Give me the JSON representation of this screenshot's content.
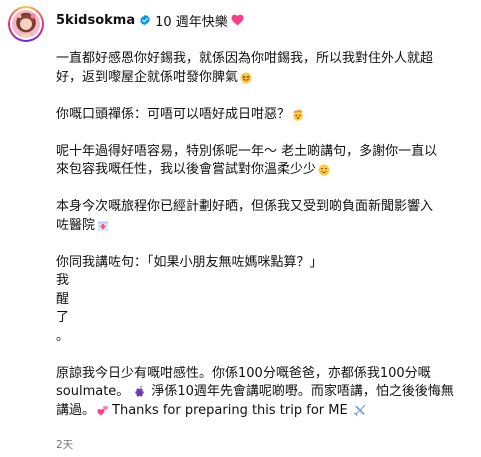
{
  "post": {
    "username": "5kidsokma",
    "title": "10 週年快樂",
    "timestamp": "2天"
  },
  "caption": {
    "p1_l1": "一直都好感恩你好錫我，就係因為你咁錫我，所以我對住外人就超",
    "p1_l2": "好，返到嚟屋企就係咁發你脾氣",
    "p2_l1": "你嘅口頭禪係：可唔可以唔好成日咁惡？",
    "p3_l1": "呢十年過得好唔容易，特別係呢一年～ 老土啲講句，多謝你一直以",
    "p3_l2": "來包容我嘅任性，我以後會嘗試對你溫柔少少",
    "p4_l1": "本身今次嘅旅程你已經計劃好晒，但係我又受到啲負面新聞影響入",
    "p4_l2": "咗醫院",
    "p5_l1": "你同我講咗句：「如果小朋友無咗媽咪點算？」",
    "p5_c1": "我",
    "p5_c2": "醒",
    "p5_c3": "了",
    "p5_c4": "。",
    "p6_l1": "原諒我今日少有嘅咁感性。你係100分嘅爸爸，亦都係我100分嘅",
    "p6_l2": "soulmate。",
    "p6_l2b": "淨係10週年先會講呢啲嘢。而家唔講，怕之後後悔無",
    "p6_l3": "講過。",
    "p6_l3b": "Thanks for preparing this trip for ME"
  },
  "icons": {
    "verified": "verified-badge-icon",
    "title_heart": "pink-heart-icon",
    "emoji_1": "tongue-face-emoji",
    "emoji_2": "exploding-head-emoji",
    "emoji_3": "smiling-face-emoji",
    "emoji_4": "hospital-emoji",
    "emoji_5": "grapes-emoji",
    "emoji_6": "two-hearts-emoji",
    "emoji_7": "airplane-emoji"
  },
  "colors": {
    "verified_blue": "#0095f6",
    "heart_pink": "#ff3d8b",
    "timestamp_gray": "#737373"
  }
}
